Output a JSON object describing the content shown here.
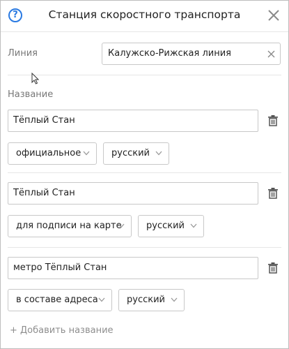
{
  "dialog": {
    "title": "Станция скоростного транспорта",
    "help_icon": "question-circle-icon",
    "close_icon": "close-x-icon"
  },
  "line": {
    "label": "Линия",
    "value": "Калужско-Рижская линия"
  },
  "names": {
    "label": "Название",
    "items": [
      {
        "value": "Тёплый Стан",
        "type": "официальное",
        "language": "русский"
      },
      {
        "value": "Тёплый Стан",
        "type": "для подписи на карте",
        "language": "русский"
      },
      {
        "value": "метро Тёплый Стан",
        "type": "в составе адреса",
        "language": "русский"
      }
    ],
    "add_label": "+ Добавить название"
  }
}
